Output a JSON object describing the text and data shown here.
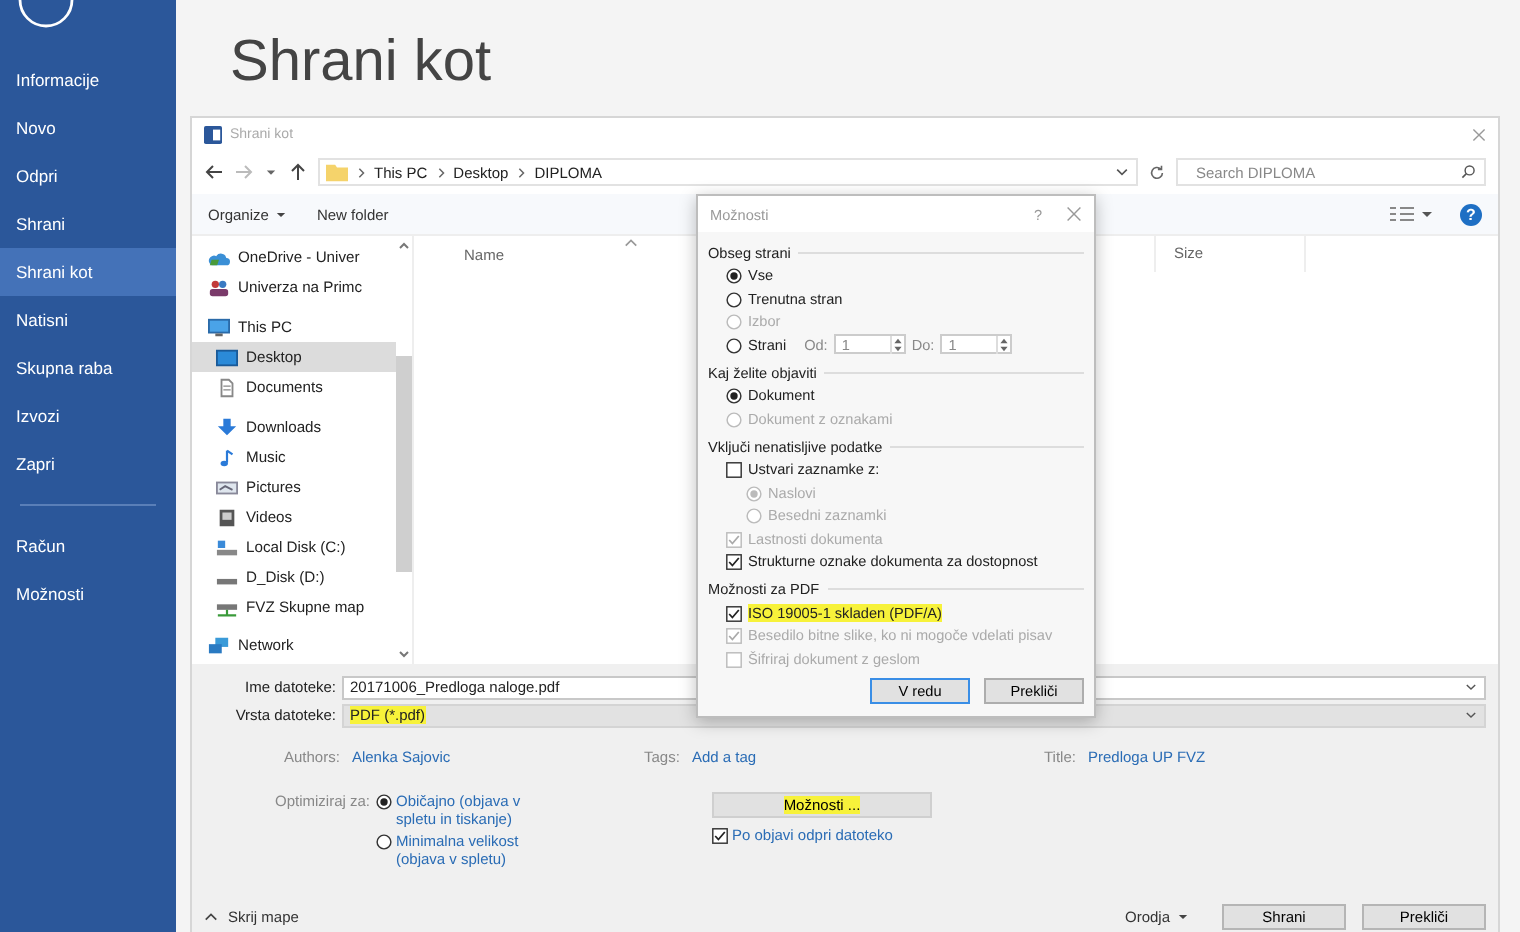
{
  "sidebar": {
    "items": [
      {
        "label": "Informacije",
        "selected": false
      },
      {
        "label": "Novo",
        "selected": false
      },
      {
        "label": "Odpri",
        "selected": false
      },
      {
        "label": "Shrani",
        "selected": false
      },
      {
        "label": "Shrani kot",
        "selected": true
      },
      {
        "label": "Natisni",
        "selected": false
      },
      {
        "label": "Skupna raba",
        "selected": false
      },
      {
        "label": "Izvozi",
        "selected": false
      },
      {
        "label": "Zapri",
        "selected": false
      }
    ],
    "account_items": [
      {
        "label": "Račun",
        "selected": false
      },
      {
        "label": "Možnosti",
        "selected": false
      }
    ]
  },
  "page_title": "Shrani kot",
  "dialog": {
    "title": "Shrani kot",
    "path": [
      "This PC",
      "Desktop",
      "DIPLOMA"
    ],
    "search_placeholder": "Search DIPLOMA",
    "organize": "Organize",
    "new_folder": "New folder",
    "help": "?",
    "nav_tree": [
      {
        "kind": "cloud",
        "label": "OneDrive - Univer",
        "selected": false
      },
      {
        "kind": "org",
        "label": "Univerza na Primc",
        "selected": false
      },
      {
        "kind": "pc",
        "label": "This PC",
        "selected": false,
        "children": [
          {
            "kind": "desktop",
            "label": "Desktop",
            "selected": true
          },
          {
            "kind": "documents",
            "label": "Documents",
            "selected": false
          },
          {
            "kind": "downloads",
            "label": "Downloads",
            "selected": false
          },
          {
            "kind": "music",
            "label": "Music",
            "selected": false
          },
          {
            "kind": "pictures",
            "label": "Pictures",
            "selected": false
          },
          {
            "kind": "videos",
            "label": "Videos",
            "selected": false
          },
          {
            "kind": "drive",
            "label": "Local Disk (C:)",
            "selected": false
          },
          {
            "kind": "disk",
            "label": "D_Disk (D:)",
            "selected": false
          },
          {
            "kind": "netdrive",
            "label": "FVZ Skupne map",
            "selected": false
          }
        ]
      },
      {
        "kind": "network",
        "label": "Network",
        "selected": false
      }
    ],
    "columns": [
      "Name",
      "Size"
    ],
    "file_name": {
      "label": "Ime datoteke:",
      "value": "20171006_Predloga naloge.pdf"
    },
    "file_type": {
      "label": "Vrsta datoteke:",
      "value": "PDF (*.pdf)",
      "highlighted": true
    },
    "meta": [
      {
        "label": "Authors:",
        "value": "Alenka Sajovic"
      },
      {
        "label": "Tags:",
        "value": "Add a tag"
      },
      {
        "label": "Title:",
        "value": "Predloga UP FVZ"
      }
    ],
    "optimize": {
      "label": "Optimiziraj za:",
      "options": [
        {
          "label": "Običajno (objava v spletu in tiskanje)",
          "selected": true
        },
        {
          "label": "Minimalna velikost (objava v spletu)",
          "selected": false
        }
      ]
    },
    "options_button": {
      "label": "Možnosti ...",
      "highlighted": true
    },
    "open_after": {
      "label": "Po objavi odpri datoteko",
      "checked": true
    },
    "hide_folders": "Skrij mape",
    "tools": "Orodja",
    "buttons": [
      "Shrani",
      "Prekliči"
    ]
  },
  "options_dialog": {
    "title": "Možnosti",
    "help": "?",
    "groups": [
      {
        "title": "Obseg strani",
        "items": [
          {
            "kind": "radio",
            "label": "Vse",
            "selected": true,
            "disabled": false
          },
          {
            "kind": "radio",
            "label": "Trenutna stran",
            "selected": false,
            "disabled": false
          },
          {
            "kind": "radio",
            "label": "Izbor",
            "selected": false,
            "disabled": true
          },
          {
            "kind": "range",
            "label": "Strani",
            "selected": false,
            "disabled": false,
            "from_label": "Od:",
            "from_value": "1",
            "to_label": "Do:",
            "to_value": "1"
          }
        ]
      },
      {
        "title": "Kaj želite objaviti",
        "items": [
          {
            "kind": "radio",
            "label": "Dokument",
            "selected": true,
            "disabled": false
          },
          {
            "kind": "radio",
            "label": "Dokument z oznakami",
            "selected": false,
            "disabled": true
          }
        ]
      },
      {
        "title": "Vključi nenatisljive podatke",
        "items": [
          {
            "kind": "checkbox",
            "label": "Ustvari zaznamke z:",
            "checked": false,
            "disabled": false,
            "children": [
              {
                "kind": "radio",
                "label": "Naslovi",
                "selected": true,
                "disabled": true
              },
              {
                "kind": "radio",
                "label": "Besedni zaznamki",
                "selected": false,
                "disabled": true
              }
            ]
          },
          {
            "kind": "checkbox",
            "label": "Lastnosti dokumenta",
            "checked": true,
            "disabled": true
          },
          {
            "kind": "checkbox",
            "label": "Strukturne oznake dokumenta za dostopnost",
            "checked": true,
            "disabled": false
          }
        ]
      },
      {
        "title": "Možnosti za PDF",
        "items": [
          {
            "kind": "checkbox",
            "label": "ISO 19005-1 skladen (PDF/A)",
            "checked": true,
            "disabled": false,
            "highlighted": true
          },
          {
            "kind": "checkbox",
            "label": "Besedilo bitne slike, ko ni mogoče vdelati pisav",
            "checked": true,
            "disabled": true
          },
          {
            "kind": "checkbox",
            "label": "Šifriraj dokument z geslom",
            "checked": false,
            "disabled": true
          }
        ]
      }
    ],
    "buttons": [
      {
        "label": "V redu",
        "default": true
      },
      {
        "label": "Prekliči",
        "default": false
      }
    ]
  }
}
